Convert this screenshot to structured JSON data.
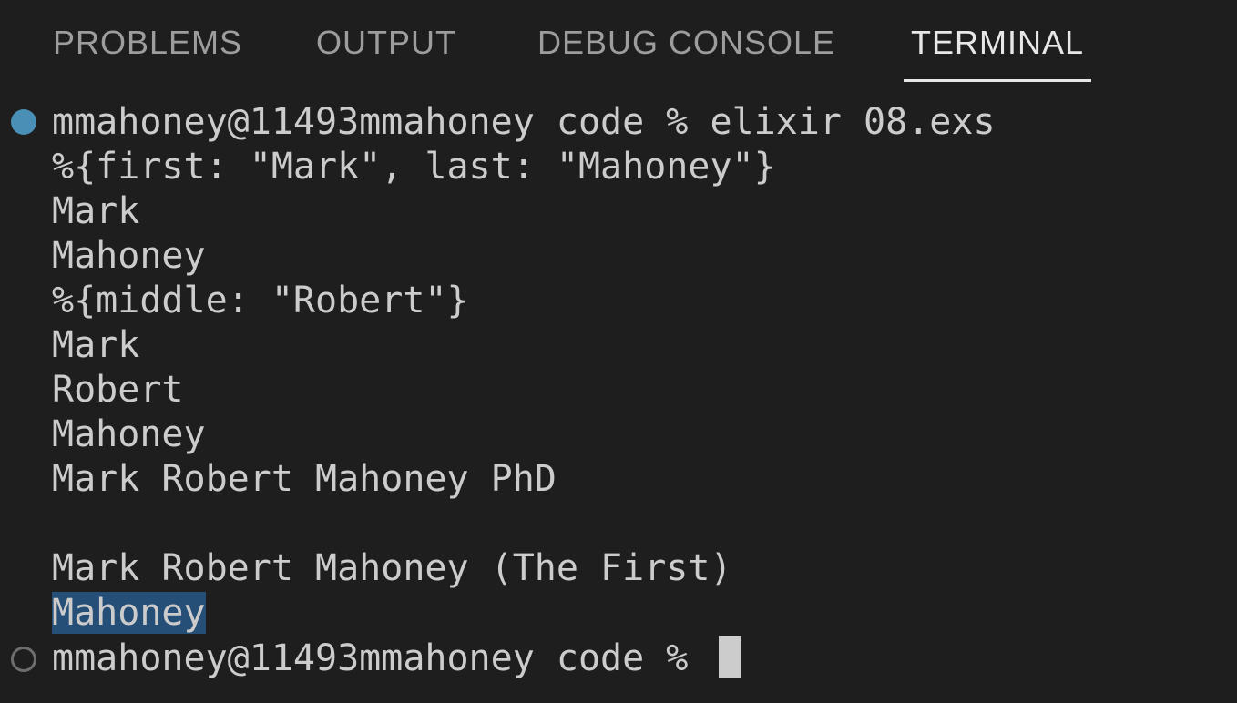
{
  "panel": {
    "tabs": [
      {
        "label": "PROBLEMS",
        "active": false
      },
      {
        "label": "OUTPUT",
        "active": false
      },
      {
        "label": "DEBUG CONSOLE",
        "active": false
      },
      {
        "label": "TERMINAL",
        "active": true
      }
    ]
  },
  "terminal": {
    "command_prompt": "mmahoney@11493mmahoney code % elixir 08.exs",
    "output_lines": [
      "%{first: \"Mark\", last: \"Mahoney\"}",
      "Mark",
      "Mahoney",
      "%{middle: \"Robert\"}",
      "Mark",
      "Robert",
      "Mahoney",
      "Mark Robert Mahoney PhD",
      "",
      "Mark Robert Mahoney (The First)"
    ],
    "selected_line": "Mahoney",
    "current_prompt": "mmahoney@11493mmahoney code % ",
    "decoration_success_color": "#4a8fb5"
  }
}
